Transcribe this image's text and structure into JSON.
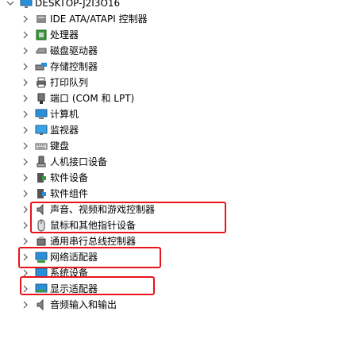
{
  "tree": {
    "root_label": "DESKTOP-J2I3O16",
    "items": [
      {
        "label": "IDE ATA/ATAPI 控制器",
        "icon": "ide-controller-icon"
      },
      {
        "label": "处理器",
        "icon": "processor-icon"
      },
      {
        "label": "磁盘驱动器",
        "icon": "disk-drive-icon"
      },
      {
        "label": "存储控制器",
        "icon": "storage-controller-icon"
      },
      {
        "label": "打印队列",
        "icon": "printer-icon"
      },
      {
        "label": "端口 (COM 和 LPT)",
        "icon": "port-icon"
      },
      {
        "label": "计算机",
        "icon": "computer-icon"
      },
      {
        "label": "监视器",
        "icon": "monitor-icon"
      },
      {
        "label": "键盘",
        "icon": "keyboard-icon"
      },
      {
        "label": "人机接口设备",
        "icon": "hid-icon"
      },
      {
        "label": "软件设备",
        "icon": "software-device-icon"
      },
      {
        "label": "软件组件",
        "icon": "software-component-icon"
      },
      {
        "label": "声音、视频和游戏控制器",
        "icon": "speaker-icon"
      },
      {
        "label": "鼠标和其他指针设备",
        "icon": "mouse-icon"
      },
      {
        "label": "通用串行总线控制器",
        "icon": "usb-icon"
      },
      {
        "label": "网络适配器",
        "icon": "network-adapter-icon"
      },
      {
        "label": "系统设备",
        "icon": "system-device-icon"
      },
      {
        "label": "显示适配器",
        "icon": "display-adapter-icon"
      },
      {
        "label": "音频输入和输出",
        "icon": "audio-io-icon"
      }
    ]
  },
  "colors": {
    "highlight_border": "#e8141a",
    "chevron": "#555555",
    "icon_blue": "#2b8fd8",
    "icon_green": "#3a9a3a"
  }
}
